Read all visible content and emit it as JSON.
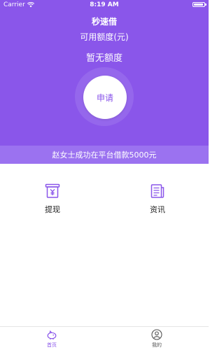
{
  "status_bar": {
    "carrier": "Carrier",
    "time": "8:19 AM"
  },
  "header": {
    "title": "秒速借",
    "credit_label": "可用额度(元)",
    "credit_value": "暂无额度",
    "apply_label": "申请"
  },
  "marquee": {
    "text": "赵女士成功在平台借款5000元"
  },
  "features": [
    {
      "label": "提现",
      "icon": "cash-register-icon"
    },
    {
      "label": "资讯",
      "icon": "news-document-icon"
    }
  ],
  "tabbar": [
    {
      "label": "首页",
      "icon": "home-piggy-icon",
      "active": true
    },
    {
      "label": "我的",
      "icon": "user-icon",
      "active": false
    }
  ],
  "colors": {
    "primary": "#8a56ea",
    "marquee_bg": "#9b72f0",
    "background": "#ffffff"
  }
}
